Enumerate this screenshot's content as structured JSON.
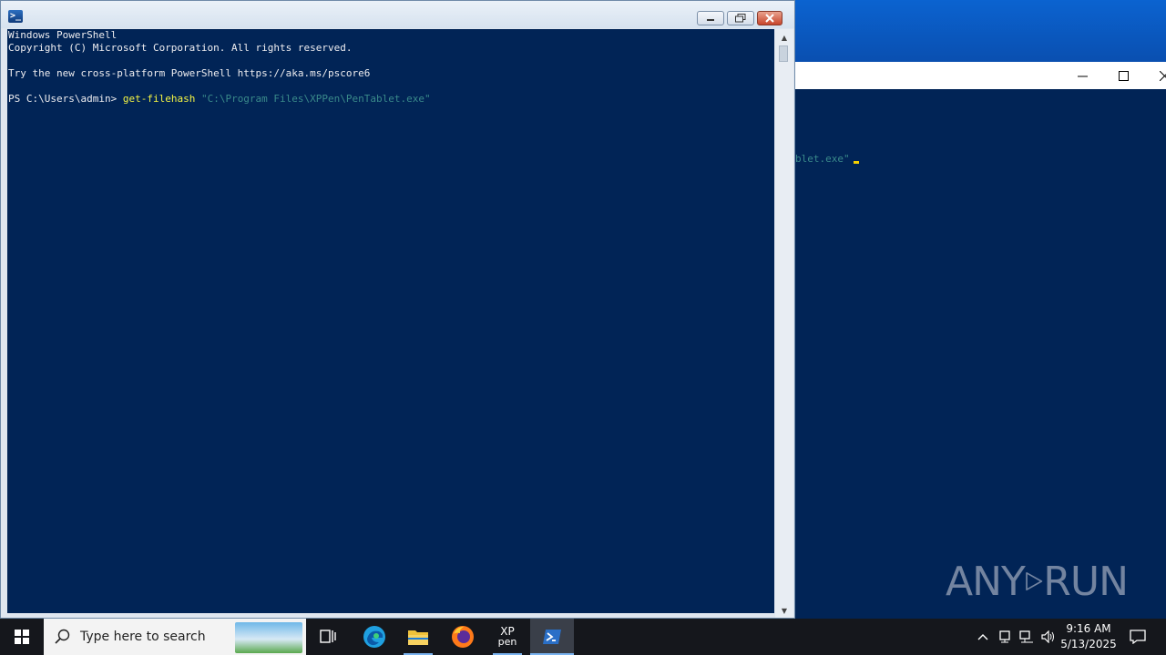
{
  "foreground_window": {
    "title_icon": "powershell-icon",
    "console_lines": {
      "line1": "Windows PowerShell",
      "line2": "Copyright (C) Microsoft Corporation. All rights reserved.",
      "line3": "",
      "line4": "Try the new cross-platform PowerShell https://aka.ms/pscore6",
      "line5": "",
      "prompt": "PS C:\\Users\\admin> ",
      "command": "get-filehash",
      "argument": "\"C:\\Program Files\\XPPen\\PenTablet.exe\""
    }
  },
  "background_window": {
    "visible_text": "blet.exe\""
  },
  "watermark": {
    "text": "RUN",
    "prefix": "ANY"
  },
  "taskbar": {
    "search_placeholder": "Type here to search",
    "apps": [
      "task-view",
      "edge",
      "file-explorer",
      "firefox",
      "xppen",
      "powershell"
    ],
    "xppen_label_top": "XP",
    "xppen_label_bottom": "pen",
    "clock_time": "9:16 AM",
    "clock_date": "5/13/2025"
  },
  "colors": {
    "console_bg": "#012456",
    "command": "#f5f543",
    "string": "#3a8a8a",
    "taskbar": "#15171c"
  }
}
